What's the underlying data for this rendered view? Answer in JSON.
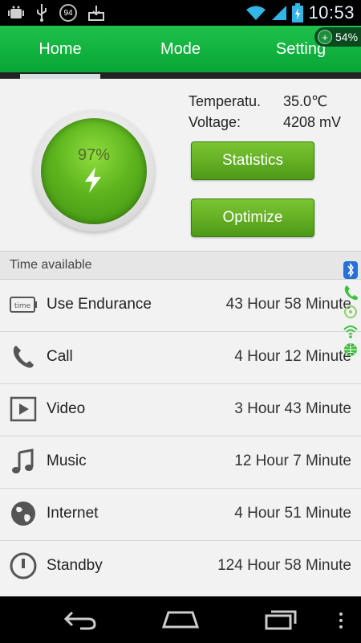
{
  "status_bar": {
    "time": "10:53",
    "badge": "94",
    "icons": [
      "android-debug-icon",
      "usb-icon",
      "badge-94-icon",
      "download-icon",
      "wifi-icon",
      "signal-icon",
      "battery-charging-icon"
    ]
  },
  "tabs": [
    {
      "label": "Home",
      "active": true
    },
    {
      "label": "Mode",
      "active": false
    },
    {
      "label": "Setting",
      "active": false
    }
  ],
  "battery_pill": {
    "percent": "54%"
  },
  "hero": {
    "battery_percent": "97%",
    "temperature_label": "Temperatu.",
    "temperature_value": "35.0℃",
    "voltage_label": "Voltage:",
    "voltage_value": "4208 mV"
  },
  "buttons": {
    "statistics": "Statistics",
    "optimize": "Optimize"
  },
  "section": {
    "title": "Time available"
  },
  "rows": [
    {
      "icon": "time-badge-icon",
      "name": "Use Endurance",
      "value": "43 Hour 58 Minute"
    },
    {
      "icon": "phone-icon",
      "name": "Call",
      "value": "4 Hour 12 Minute"
    },
    {
      "icon": "video-play-icon",
      "name": "Video",
      "value": "3 Hour 43 Minute"
    },
    {
      "icon": "music-note-icon",
      "name": "Music",
      "value": "12 Hour 7 Minute"
    },
    {
      "icon": "globe-icon",
      "name": "Internet",
      "value": "4 Hour 51 Minute"
    },
    {
      "icon": "power-icon",
      "name": "Standby",
      "value": "124 Hour 58 Minute"
    }
  ],
  "colors": {
    "accent_green": "#0fb23f",
    "button_green": "#5fae22",
    "orb_green": "#5cb51e"
  }
}
